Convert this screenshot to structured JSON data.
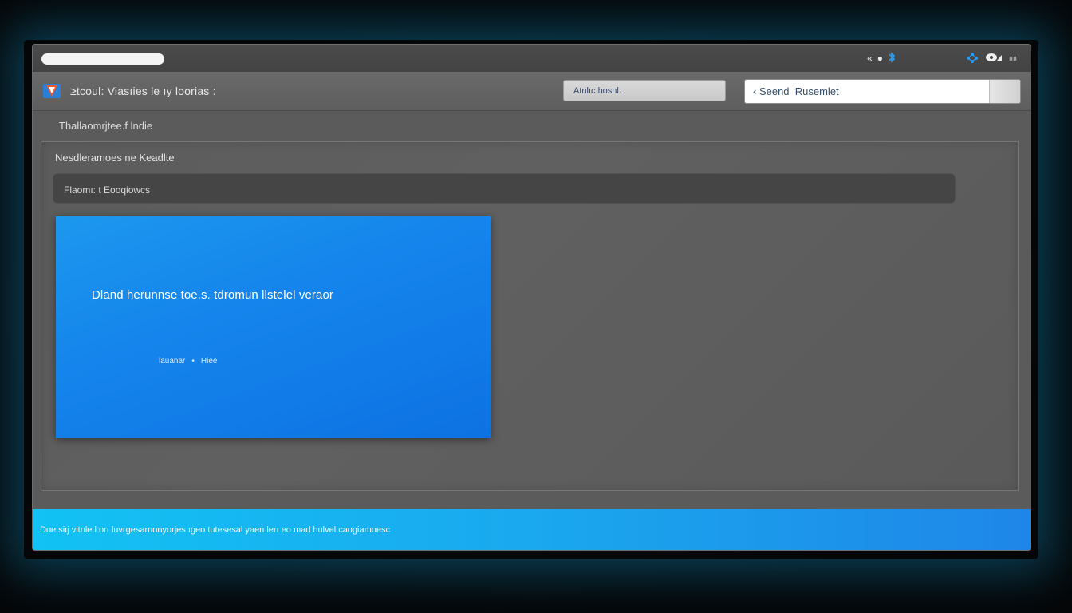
{
  "titlebar": {
    "status_icons": [
      "chevron-left-icon",
      "dot-icon",
      "bluetooth-icon"
    ],
    "tray_icons": [
      "network-icon",
      "camera-icon"
    ],
    "tray_label": "ıııı"
  },
  "toolbar": {
    "app_title": "≥tcoul:  Viasıies  le  ıy  loorias :",
    "account_label": "Atnlıc.hosnl.",
    "search_placeholder": "‹ Seend  Rusemlet"
  },
  "breadcrumb": "Thallaomrjtee.f  lndie",
  "panel": {
    "title": "Nesdleramoes  ne  Keadlte",
    "filter_label": "Flaomı: t Eooqiowcs"
  },
  "card": {
    "headline": "Dland  herunnse  toe.s.  tdromun  llstelel  veraor",
    "meta_left": "lauanar",
    "meta_sep": "•",
    "meta_right": "Hiee"
  },
  "footer": {
    "text": "Doetsiıj  vitnle  l  orı  luvrgesarnonyorjes  ıgeo  tutesesal  yaen  lerı  eo  mad  hulvel  caogiamoesc"
  },
  "colors": {
    "accent_blue": "#1585ec",
    "footer_cyan": "#12c2f4",
    "window_gray": "#5b5b5b"
  }
}
